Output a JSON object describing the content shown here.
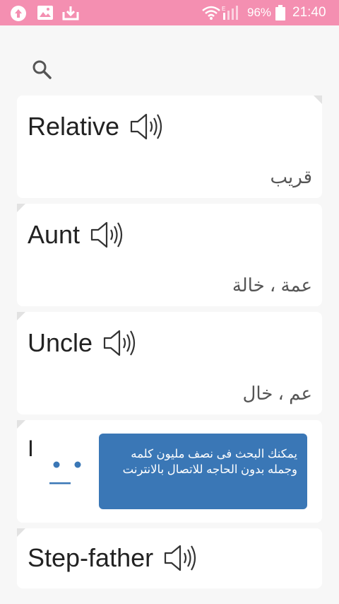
{
  "status_bar": {
    "battery": "96%",
    "time": "21:40",
    "icons": [
      "upload-icon",
      "image-icon",
      "download-icon",
      "wifi-icon",
      "signal-icon",
      "battery-icon"
    ],
    "color": "#f48fb1"
  },
  "search": {
    "icon": "search-icon"
  },
  "cards": [
    {
      "word": "Relative",
      "meaning": "قريب"
    },
    {
      "word": "Aunt",
      "meaning": "عمة ، خالة"
    },
    {
      "word": "Uncle",
      "meaning": "عم ، خال"
    },
    {
      "word": "I",
      "meaning": ""
    },
    {
      "word": "Step-father",
      "meaning": ""
    }
  ],
  "tooltip": {
    "text": "يمكنك البحث فى نصف مليون كلمه وجمله بدون الحاجه للاتصال بالانترنت",
    "color": "#3a77b6"
  }
}
